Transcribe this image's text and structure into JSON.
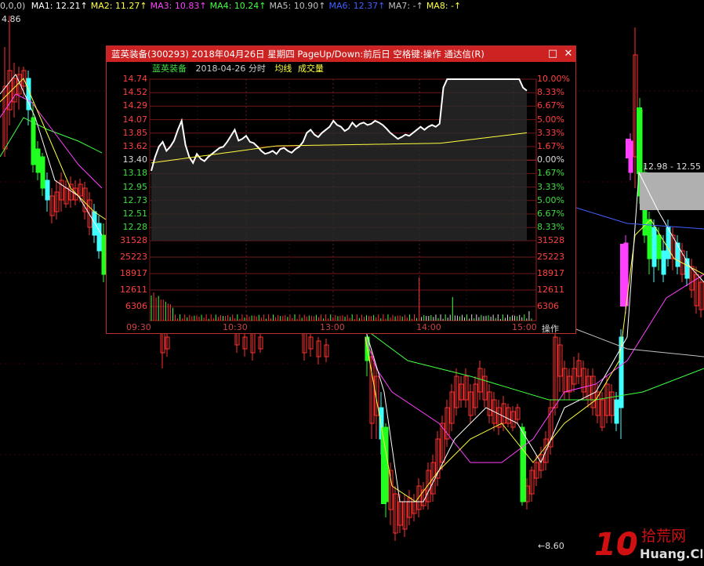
{
  "ma_bar": {
    "lead": "0,0,0)",
    "items": [
      {
        "label": "MA1: 12.21",
        "color": "#ffffff"
      },
      {
        "label": "MA2: 11.27",
        "color": "#ffff40"
      },
      {
        "label": "MA3: 10.83",
        "color": "#ff40ff"
      },
      {
        "label": "MA4: 10.24",
        "color": "#40ff40"
      },
      {
        "label": "MA5: 10.90",
        "color": "#c0c0c0"
      },
      {
        "label": "MA6: 12.37",
        "color": "#4060ff"
      },
      {
        "label": "MA7: -",
        "color": "#c0c0c0"
      },
      {
        "label": "MA8: -",
        "color": "#ffff40"
      }
    ],
    "arrow": "↑"
  },
  "main_chart": {
    "high_label": "4.86",
    "low_label": "8.60",
    "range_label": "12.98 - 12.55"
  },
  "popup": {
    "title": "蓝英装备(300293) 2018年04月26日 星期四 PageUp/Down:前后日 空格键:操作 通达信(R)",
    "restore_icon": "□",
    "close_icon": "✕",
    "stock_name": "蓝英装备",
    "date_label": "2018-04-26 分时",
    "avg_label": "均线",
    "vol_label": "成交量",
    "operate_label": "操作",
    "price_ticks": [
      {
        "left": "14.74",
        "right": "10.00%",
        "color": "#ff4040"
      },
      {
        "left": "14.52",
        "right": "8.33%",
        "color": "#ff4040"
      },
      {
        "left": "14.29",
        "right": "6.67%",
        "color": "#ff4040"
      },
      {
        "left": "14.07",
        "right": "5.00%",
        "color": "#ff4040"
      },
      {
        "left": "13.85",
        "right": "3.33%",
        "color": "#ff4040"
      },
      {
        "left": "13.62",
        "right": "1.67%",
        "color": "#ff4040"
      },
      {
        "left": "13.40",
        "right": "0.00%",
        "color": "#dddddd"
      },
      {
        "left": "13.18",
        "right": "1.67%",
        "color": "#40dd40"
      },
      {
        "left": "12.95",
        "right": "3.33%",
        "color": "#40dd40"
      },
      {
        "left": "12.73",
        "right": "5.00%",
        "color": "#40dd40"
      },
      {
        "left": "12.51",
        "right": "6.67%",
        "color": "#40dd40"
      },
      {
        "left": "12.28",
        "right": "8.33%",
        "color": "#40dd40"
      }
    ],
    "vol_ticks": [
      "31528",
      "25223",
      "18917",
      "12611",
      "6306"
    ],
    "time_ticks": [
      "09:30",
      "10:30",
      "13:00",
      "14:00",
      "15:00"
    ],
    "intraday": {
      "prev_close": 13.4,
      "ylim": [
        12.06,
        14.74
      ]
    }
  },
  "watermark": {
    "brand_big": "10",
    "brand_cn": "拾荒网",
    "brand_site": "Huang.CN"
  }
}
